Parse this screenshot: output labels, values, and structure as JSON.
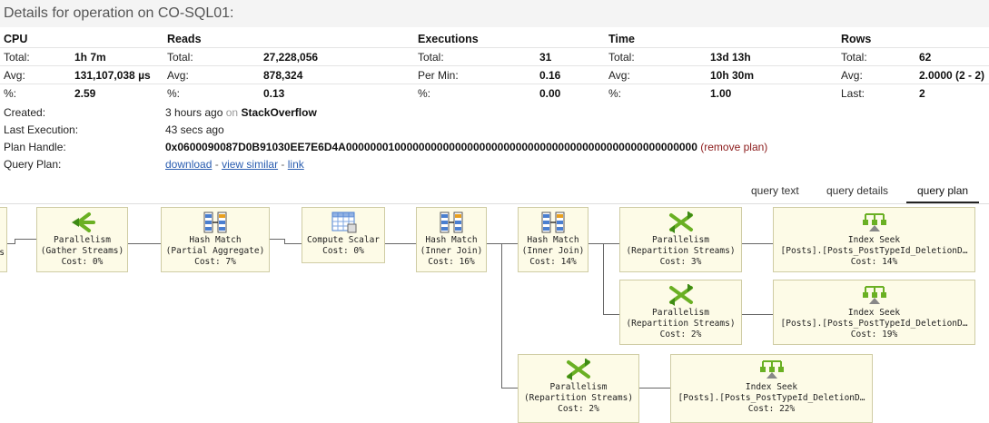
{
  "title": "Details for operation on CO-SQL01:",
  "stats": {
    "cpu": {
      "header": "CPU",
      "rows": [
        [
          "Total:",
          "1h 7m"
        ],
        [
          "Avg:",
          "131,107,038 µs"
        ],
        [
          "%:",
          "2.59"
        ]
      ]
    },
    "reads": {
      "header": "Reads",
      "rows": [
        [
          "Total:",
          "27,228,056"
        ],
        [
          "Avg:",
          "878,324"
        ],
        [
          "%:",
          "0.13"
        ]
      ]
    },
    "executions": {
      "header": "Executions",
      "rows": [
        [
          "Total:",
          "31"
        ],
        [
          "Per Min:",
          "0.16"
        ],
        [
          "%:",
          "0.00"
        ]
      ]
    },
    "time": {
      "header": "Time",
      "rows": [
        [
          "Total:",
          "13d 13h"
        ],
        [
          "Avg:",
          "10h 30m"
        ],
        [
          "%:",
          "1.00"
        ]
      ]
    },
    "rowsStat": {
      "header": "Rows",
      "rows": [
        [
          "Total:",
          "62"
        ],
        [
          "Avg:",
          "2.0000 (2 - 2)"
        ],
        [
          "Last:",
          "2"
        ]
      ]
    }
  },
  "meta": {
    "created_label": "Created:",
    "created_value": "3 hours ago",
    "created_on": "on",
    "created_db": "StackOverflow",
    "last_exec_label": "Last Execution:",
    "last_exec_value": "43 secs ago",
    "plan_handle_label": "Plan Handle:",
    "plan_handle_value": "0x0600090087D0B91030EE7E6D4A0000000100000000000000000000000000000000000000000000000000",
    "remove_plan": "(remove plan)",
    "query_plan_label": "Query Plan:",
    "download": "download",
    "view_similar": "view similar",
    "link": "link",
    "dash": "-"
  },
  "tabs": {
    "query_text": "query text",
    "query_details": "query details",
    "query_plan": "query plan"
  },
  "nodes": {
    "n1": {
      "l1": "Parallelism",
      "l2": "(Gather Streams)",
      "l3": "Cost: 0%"
    },
    "n2": {
      "l1": "Hash Match",
      "l2": "(Partial Aggregate)",
      "l3": "Cost: 7%"
    },
    "n3": {
      "l1": "Compute Scalar",
      "l2": "Cost: 0%"
    },
    "n4": {
      "l1": "Hash Match",
      "l2": "(Inner Join)",
      "l3": "Cost: 16%"
    },
    "n5": {
      "l1": "Hash Match",
      "l2": "(Inner Join)",
      "l3": "Cost: 14%"
    },
    "n6": {
      "l1": "Parallelism",
      "l2": "(Repartition Streams)",
      "l3": "Cost: 3%"
    },
    "n7": {
      "l1": "Index Seek",
      "l2": "[Posts].[Posts_PostTypeId_DeletionD…",
      "l3": "Cost: 14%"
    },
    "n8": {
      "l1": "Parallelism",
      "l2": "(Repartition Streams)",
      "l3": "Cost: 2%"
    },
    "n9": {
      "l1": "Index Seek",
      "l2": "[Posts].[Posts_PostTypeId_DeletionD…",
      "l3": "Cost: 19%"
    },
    "n10": {
      "l1": "Parallelism",
      "l2": "(Repartition Streams)",
      "l3": "Cost: 2%"
    },
    "n11": {
      "l1": "Index Seek",
      "l2": "[Posts].[Posts_PostTypeId_DeletionD…",
      "l3": "Cost: 22%"
    },
    "partial_left": {
      "l2": "s"
    }
  }
}
